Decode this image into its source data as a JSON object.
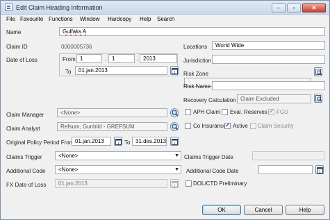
{
  "window": {
    "title": "Edit Claim Heading Information"
  },
  "menu": [
    "File",
    "Favourite",
    "Functions",
    "Window",
    "Hardcopy",
    "Help",
    "Search"
  ],
  "form": {
    "name_label": "Name",
    "name_value": "Gulfaks A",
    "claim_id_label": "Claim ID",
    "claim_id_value": "0000005736",
    "date_of_loss_label": "Date of Loss",
    "from_label": "From",
    "from_day": "1",
    "from_month": "1",
    "from_year": "2013",
    "to_label": "To",
    "to_value": "01.jan.2013",
    "locations_label": "Locations",
    "locations_value": "World Wide",
    "jurisdiction_label": "Jurisdiction",
    "jurisdiction_value": "",
    "risk_zone_label": "Risk Zone",
    "risk_zone_value": "",
    "risk_name_label": "Risk Name",
    "risk_name_value": "",
    "recovery_calc_label": "Recovery Calculation",
    "recovery_calc_value": "Claim Excluded",
    "claim_manager_label": "Claim Manager",
    "claim_manager_value": "<None>",
    "claim_analyst_label": "Claim Analyst",
    "claim_analyst_value": "Refsum, Gunhild - GREFSUM",
    "orig_period_label": "Original Policy Period From",
    "orig_period_from": "01.jan.2013",
    "orig_period_to_label": "To",
    "orig_period_to": "31.des.2013",
    "claims_trigger_label": "Claims Trigger",
    "claims_trigger_value": "<None>",
    "additional_code_label": "Additional Code",
    "additional_code_value": "<None>",
    "fx_date_label": "FX Date of Loss",
    "fx_date_value": "01.jan.2013",
    "claims_trigger_date_label": "Claims Trigger Date",
    "claims_trigger_date_value": "",
    "additional_code_date_label": "Additional Code Date",
    "additional_code_date_value": ""
  },
  "checkboxes": {
    "aph_claim": "APH Claim",
    "eval_reserves": "Eval. Reserves",
    "fgu": "FGU",
    "co_insurance": "Co Insurance",
    "active": "Active",
    "claim_security": "Claim Security",
    "dol_ctd": "DOL/CTD Preliminary"
  },
  "buttons": {
    "ok": "OK",
    "cancel": "Cancel",
    "help": "Help"
  }
}
